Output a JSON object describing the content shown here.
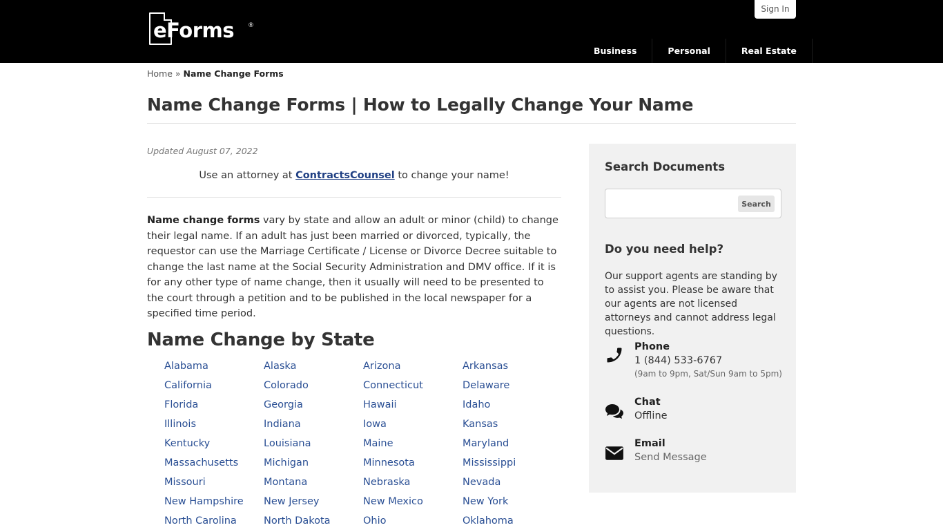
{
  "header": {
    "logo_text": "eForms",
    "logo_mark": "®",
    "signin_label": "Sign In",
    "nav": [
      "Business",
      "Personal",
      "Real Estate"
    ]
  },
  "breadcrumb": {
    "home": "Home",
    "separator": "»",
    "current": "Name Change Forms"
  },
  "page_title": "Name Change Forms | How to Legally Change Your Name",
  "main": {
    "updated": "Updated August 07, 2022",
    "attorney_prefix": "Use an attorney at ",
    "attorney_link": "ContractsCounsel",
    "attorney_suffix": " to change your name!",
    "intro_bold": "Name change forms",
    "intro_text": " vary by state and allow an adult or minor (child) to change their legal name. If an adult has just been married or divorced, typically, the requestor can use the Marriage Certificate / License or Divorce Decree suitable to change the last name at the Social Security Administration and DMV office. If it is for any other type of name change, then it usually will need to be presented to the court through a petition and to be published in the local newspaper for a specified time period.",
    "state_heading": "Name Change by State",
    "states": [
      "Alabama",
      "Alaska",
      "Arizona",
      "Arkansas",
      "California",
      "Colorado",
      "Connecticut",
      "Delaware",
      "Florida",
      "Georgia",
      "Hawaii",
      "Idaho",
      "Illinois",
      "Indiana",
      "Iowa",
      "Kansas",
      "Kentucky",
      "Louisiana",
      "Maine",
      "Maryland",
      "Massachusetts",
      "Michigan",
      "Minnesota",
      "Mississippi",
      "Missouri",
      "Montana",
      "Nebraska",
      "Nevada",
      "New Hampshire",
      "New Jersey",
      "New Mexico",
      "New York",
      "North Carolina",
      "North Dakota",
      "Ohio",
      "Oklahoma"
    ]
  },
  "sidebar": {
    "search_heading": "Search Documents",
    "search_placeholder": "",
    "search_button": "Search",
    "help_heading": "Do you need help?",
    "help_text": "Our support agents are standing by to assist you. Please be aware that our agents are not licensed attorneys and cannot address legal questions.",
    "phone": {
      "label": "Phone",
      "value": "1 (844) 533-6767",
      "hours": "(9am to 9pm, Sat/Sun 9am to 5pm)",
      "icon": "phone-icon"
    },
    "chat": {
      "label": "Chat",
      "value": "Offline",
      "icon": "chat-icon"
    },
    "email": {
      "label": "Email",
      "value": "Send Message",
      "icon": "envelope-icon"
    }
  },
  "colors": {
    "header_bg": "#000000",
    "link": "#2a4f94",
    "sidebar_bg": "#f1f1f1"
  }
}
